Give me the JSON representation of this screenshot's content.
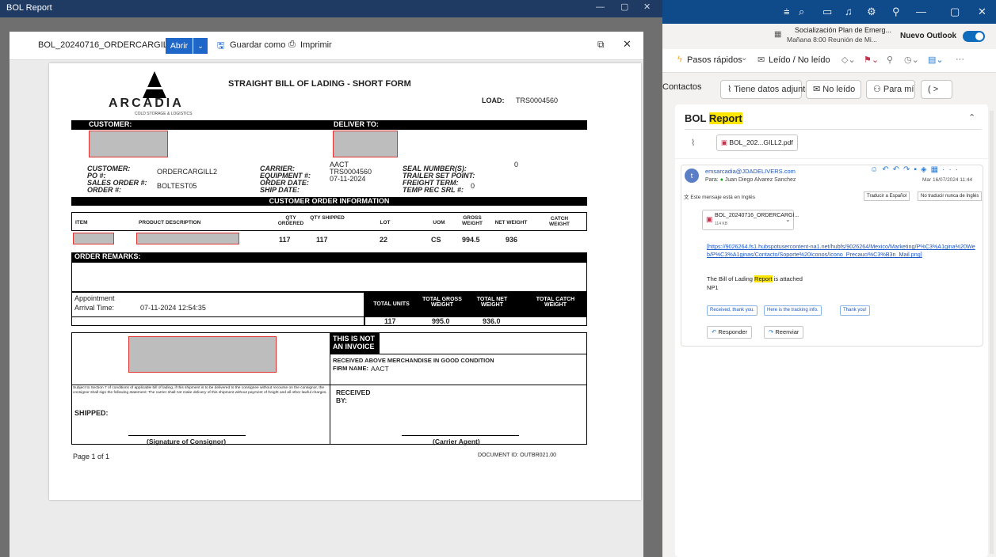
{
  "viewer": {
    "window_title": "BOL Report",
    "filename": "BOL_20240716_ORDERCARGILL2.pdf",
    "open_label": "Abrir",
    "save_as_label": "Guardar como",
    "print_label": "Imprimir"
  },
  "bol": {
    "title": "STRAIGHT BILL OF LADING - SHORT FORM",
    "logo_text": "ARCADIA",
    "logo_sub": "COLD STORAGE & LOGISTICS",
    "load_label": "LOAD:",
    "load_value": "TRS0004560",
    "customer_bar": "CUSTOMER:",
    "deliver_bar": "DELIVER TO:",
    "left_fields": [
      {
        "label": "CUSTOMER:",
        "value": ""
      },
      {
        "label": "PO #:",
        "value": "ORDERCARGILL2"
      },
      {
        "label": "SALES ORDER #:",
        "value": ""
      },
      {
        "label": "ORDER #:",
        "value": "BOLTEST05"
      }
    ],
    "mid_fields": [
      {
        "label": "CARRIER:",
        "value": "AACT"
      },
      {
        "label": "EQUIPMENT #:",
        "value": "TRS0004560"
      },
      {
        "label": "ORDER DATE:",
        "value": "07-11-2024"
      },
      {
        "label": "SHIP DATE:",
        "value": ""
      }
    ],
    "right_fields": [
      {
        "label": "SEAL NUMBER(S):",
        "value": "0"
      },
      {
        "label": "TRAILER SET POINT:",
        "value": ""
      },
      {
        "label": "FREIGHT TERM:",
        "value": ""
      },
      {
        "label": "TEMP REC SRL #:",
        "value": "0"
      }
    ],
    "coi_bar": "CUSTOMER ORDER INFORMATION",
    "table_headers": [
      "ITEM",
      "PRODUCT DESCRIPTION",
      "QTY ORDERED",
      "QTY SHIPPED",
      "LOT",
      "UOM",
      "GROSS WEIGHT",
      "NET WEIGHT",
      "CATCH WEIGHT"
    ],
    "row": {
      "qty_ordered": "117",
      "qty_shipped": "117",
      "lot": "22",
      "uom": "CS",
      "gross": "994.5",
      "net": "936"
    },
    "remarks_bar": "ORDER REMARKS:",
    "appointment_label": "Appointment",
    "arrival_label": "Arrival Time:",
    "arrival_value": "07-11-2024 12:54:35",
    "totals_headers": [
      "TOTAL UNITS",
      "TOTAL GROSS WEIGHT",
      "TOTAL NET WEIGHT",
      "TOTAL CATCH WEIGHT"
    ],
    "totals_values": [
      "117",
      "995.0",
      "936.0",
      ""
    ],
    "not_invoice": "THIS IS NOT AN INVOICE",
    "received_cond": "RECEIVED ABOVE MERCHANDISE IN GOOD CONDITION",
    "firm_label": "FIRM NAME:",
    "firm_value": "AACT",
    "terms": "Subject to Section 7 of conditions of applicable bill of lading, if this shipment is to be delivered to the consignee without recourse on the consignor, the consignor shall sign the following statement: The carrier shall not make delivery of this shipment without payment of freight and all other lawful charges.",
    "shipped_label": "SHIPPED:",
    "received_by": "RECEIVED BY:",
    "sig_consignor": "(Signature of Consignor)",
    "carrier_agent": "(Carrier Agent)",
    "page_label": "Page 1  of 1",
    "document_id": "DOCUMENT ID: OUTBR021.00"
  },
  "outlook": {
    "notif_title": "Socialización Plan de Emerg...",
    "notif_sub": "Mañana 8:00 Reunión de Mi...",
    "new_outlook": "Nuevo Outlook",
    "toolbar": {
      "quick_steps": "Pasos rápidos",
      "read_unread": "Leído / No leído"
    },
    "filters": [
      "Contactos",
      "Tiene datos adjuntos",
      "No leído",
      "Para mí"
    ],
    "subject_prefix": "BOL ",
    "subject_highlight": "Report",
    "attachment_chip": "BOL_202...GILL2.pdf",
    "sender": "emsarcadia@JDADELIVERS.com",
    "to_label": "Para:",
    "to_name": "Juan Diego Alvarez Sanchez",
    "date": "Mar 16/07/2024 11:44",
    "lang_notice": "Este mensaje está en Inglés",
    "translate_btn": "Traducir a Español",
    "never_translate_btn": "No traducir nunca de Inglés",
    "attachment_name": "BOL_20240716_ORDERCARGI...",
    "attachment_size": "114 KB",
    "link": "[https://9026264.fs1.hubspotusercontent-na1.net/hubfs/9026264/Mexico/Marketing/P%C3%A1gina%20Web/P%C3%A1ginas/Contacto/Soporte%20Iconos/Icono_Precauci%C3%B3n_Mail.png]",
    "body_pre": "The Bill of Lading ",
    "body_highlight": "Report",
    "body_post": " is attached",
    "body_sig": "NP1",
    "suggested": [
      "Received, thank you.",
      "Here is the tracking info.",
      "Thank you!"
    ],
    "reply": "Responder",
    "forward": "Reenviar"
  },
  "colors": {
    "outlook_blue": "#0f4a8a",
    "link": "#1a56c4",
    "highlight": "#ffe600"
  }
}
